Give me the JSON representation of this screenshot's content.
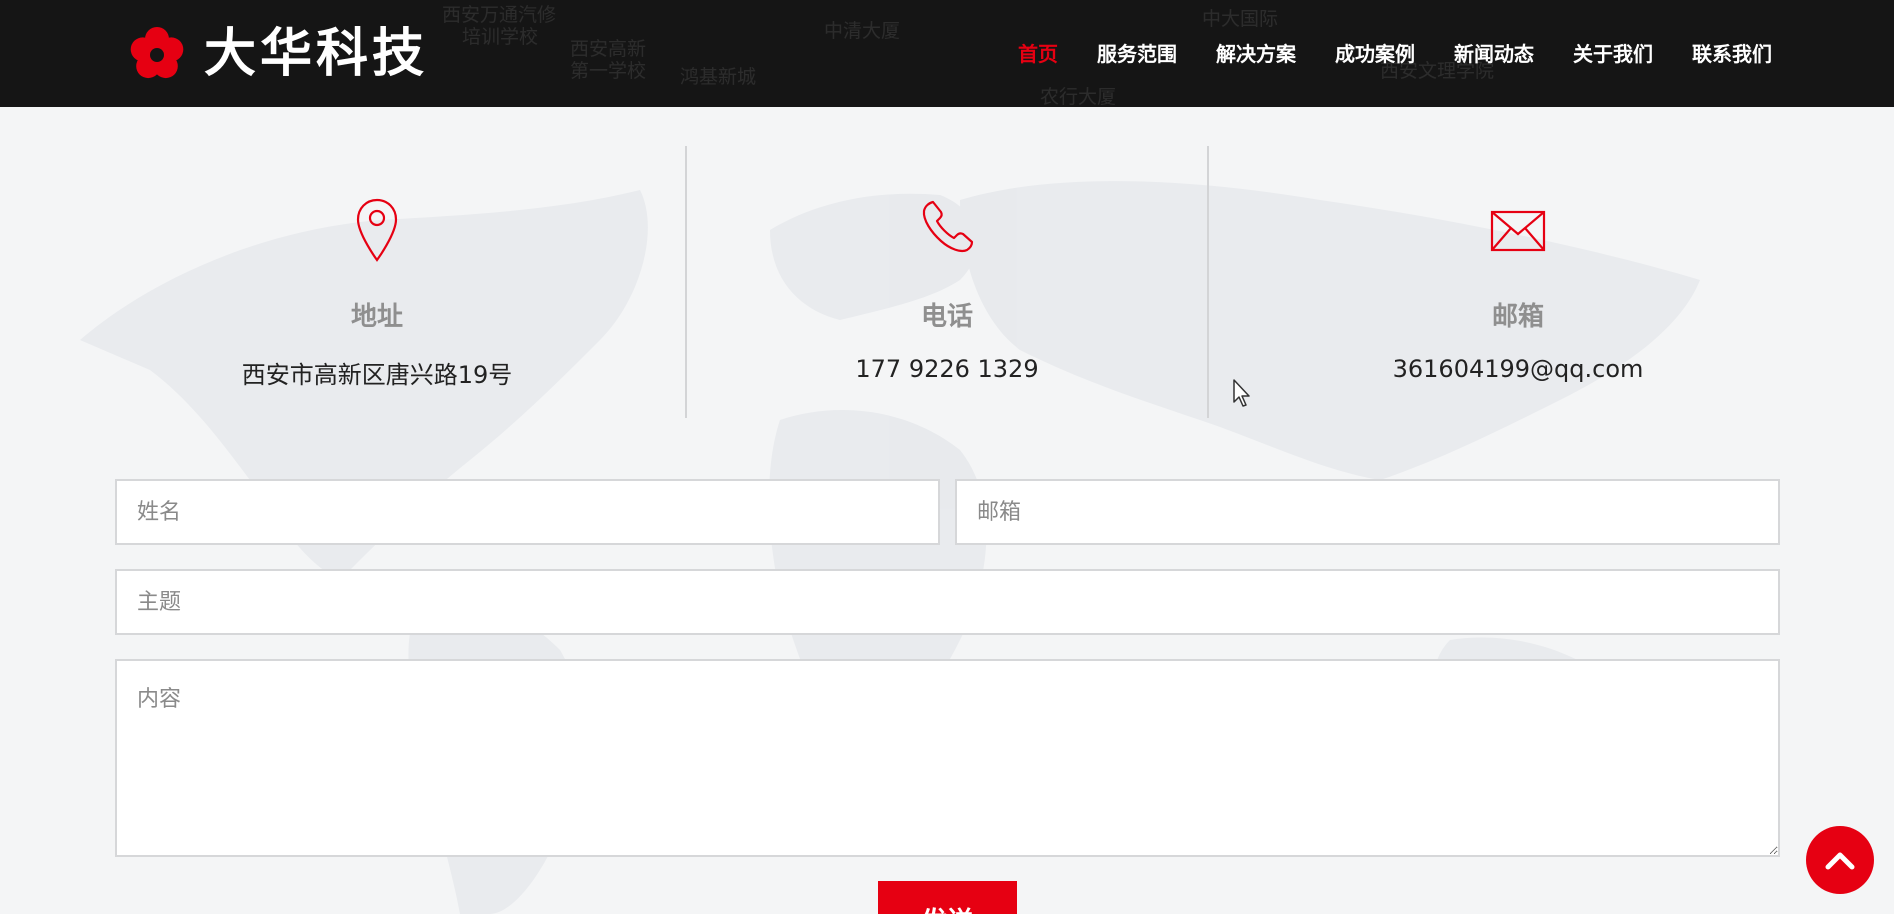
{
  "brand": {
    "name": "大华科技",
    "accent_color": "#e60012"
  },
  "header": {
    "background_labels": [
      "西安万通汽修",
      "培训学校",
      "西安高新",
      "第一学校",
      "鸿基新城",
      "中清大厦",
      "中大国际",
      "农行大厦",
      "西安文理学院"
    ]
  },
  "nav": {
    "items": [
      {
        "label": "首页",
        "active": true
      },
      {
        "label": "服务范围",
        "active": false
      },
      {
        "label": "解决方案",
        "active": false
      },
      {
        "label": "成功案例",
        "active": false
      },
      {
        "label": "新闻动态",
        "active": false
      },
      {
        "label": "关于我们",
        "active": false
      },
      {
        "label": "联系我们",
        "active": false
      }
    ]
  },
  "contact": {
    "address": {
      "title": "地址",
      "value": "西安市高新区唐兴路19号",
      "icon": "location-pin-icon"
    },
    "phone": {
      "title": "电话",
      "value": "177 9226 1329",
      "icon": "phone-icon"
    },
    "email": {
      "title": "邮箱",
      "value": "361604199@qq.com",
      "icon": "envelope-icon"
    }
  },
  "form": {
    "name_placeholder": "姓名",
    "email_placeholder": "邮箱",
    "subject_placeholder": "主题",
    "content_placeholder": "内容",
    "submit_label": "发送"
  },
  "back_to_top_icon": "chevron-up-icon"
}
